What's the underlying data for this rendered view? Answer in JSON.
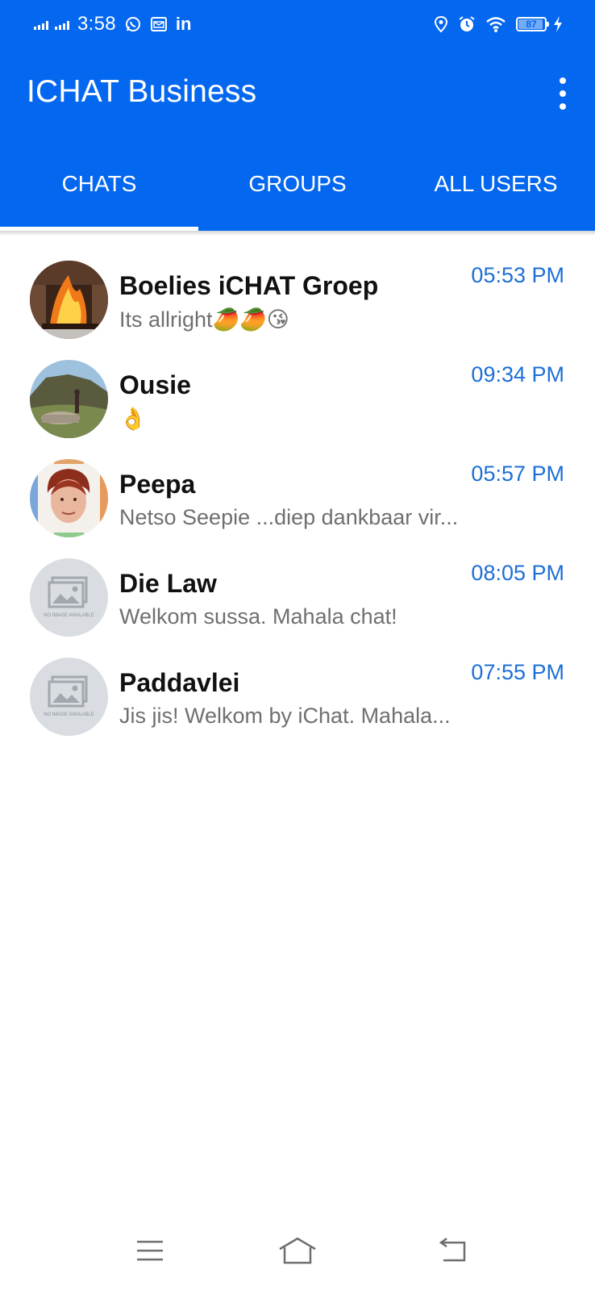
{
  "status_bar": {
    "time": "3:58",
    "battery": "87",
    "icons": [
      "signal-icon",
      "signal-icon",
      "whatsapp-icon",
      "email-icon",
      "linkedin-icon",
      "location-icon",
      "alarm-icon",
      "wifi-icon",
      "battery-icon",
      "charging-icon"
    ],
    "linkedin_text": "in"
  },
  "app_bar": {
    "title": "ICHAT Business",
    "menu_icon": "more-vert-icon",
    "color": "#0467ef"
  },
  "tabs": [
    {
      "label": "CHATS",
      "active": true
    },
    {
      "label": "GROUPS",
      "active": false
    },
    {
      "label": "ALL USERS",
      "active": false
    }
  ],
  "chats": [
    {
      "name": "Boelies iCHAT Groep",
      "message": "Its allright🥭🥭😘",
      "time": "05:53 PM"
    },
    {
      "name": "Ousie",
      "message": "👌",
      "time": "09:34 PM"
    },
    {
      "name": "Peepa",
      "message": "Netso Seepie ...diep dankbaar vir...",
      "time": "05:57 PM"
    },
    {
      "name": "Die Law",
      "message": "Welkom sussa. Mahala chat!",
      "time": "08:05 PM"
    },
    {
      "name": "Paddavlei",
      "message": "Jis jis! Welkom by iChat. Mahala...",
      "time": "07:55 PM"
    }
  ],
  "placeholder_avatar_text": "NO IMAGE AVAILABLE",
  "accent_time_color": "#1d6fd6",
  "nav_bar": {
    "icons": [
      "menu-icon",
      "home-icon",
      "back-icon"
    ]
  }
}
